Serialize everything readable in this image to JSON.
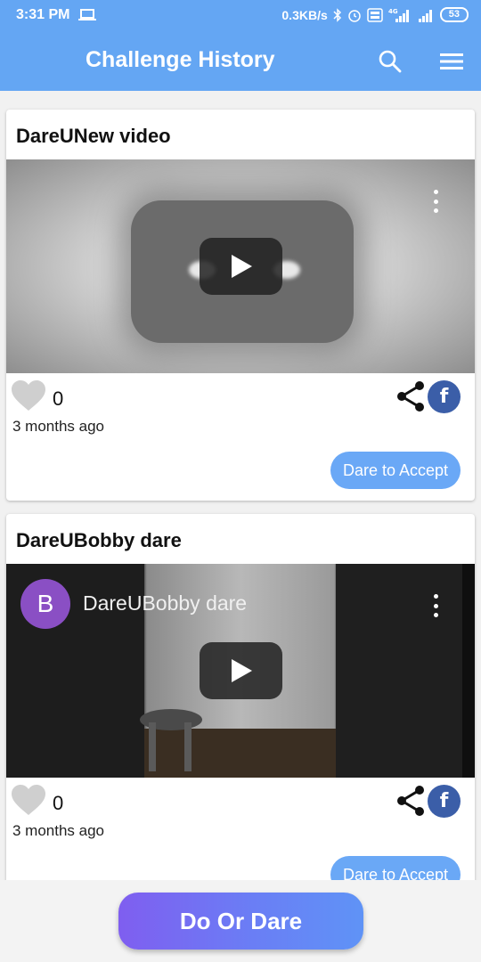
{
  "status_bar": {
    "time": "3:31 PM",
    "network_speed": "0.3KB/s",
    "battery": "53",
    "icons": [
      "laptop-icon",
      "bluetooth-icon",
      "alarm-icon",
      "volte-icon",
      "signal-4g-icon",
      "signal-icon",
      "battery-icon"
    ]
  },
  "app_bar": {
    "title": "Challenge History",
    "actions": [
      "search-icon",
      "menu-icon"
    ]
  },
  "feed": [
    {
      "title": "DareUNew video",
      "video": {
        "overlay_title": "",
        "thumbnail": "youtube-placeholder"
      },
      "likes": "0",
      "time_ago": "3 months ago",
      "action_label": "Dare to Accept"
    },
    {
      "title": "DareUBobby dare",
      "video": {
        "overlay_title": "DareUBobby dare",
        "channel_initial": "B",
        "thumbnail": "room-with-stool"
      },
      "likes": "0",
      "time_ago": "3 months ago",
      "action_label": "Dare to Accept"
    }
  ],
  "bottom_action": {
    "label": "Do Or Dare"
  },
  "colors": {
    "primary": "#64a6f3",
    "facebook": "#3b5ea8",
    "dare_button": "#6aa8f6",
    "avatar": "#8a4fc4"
  }
}
